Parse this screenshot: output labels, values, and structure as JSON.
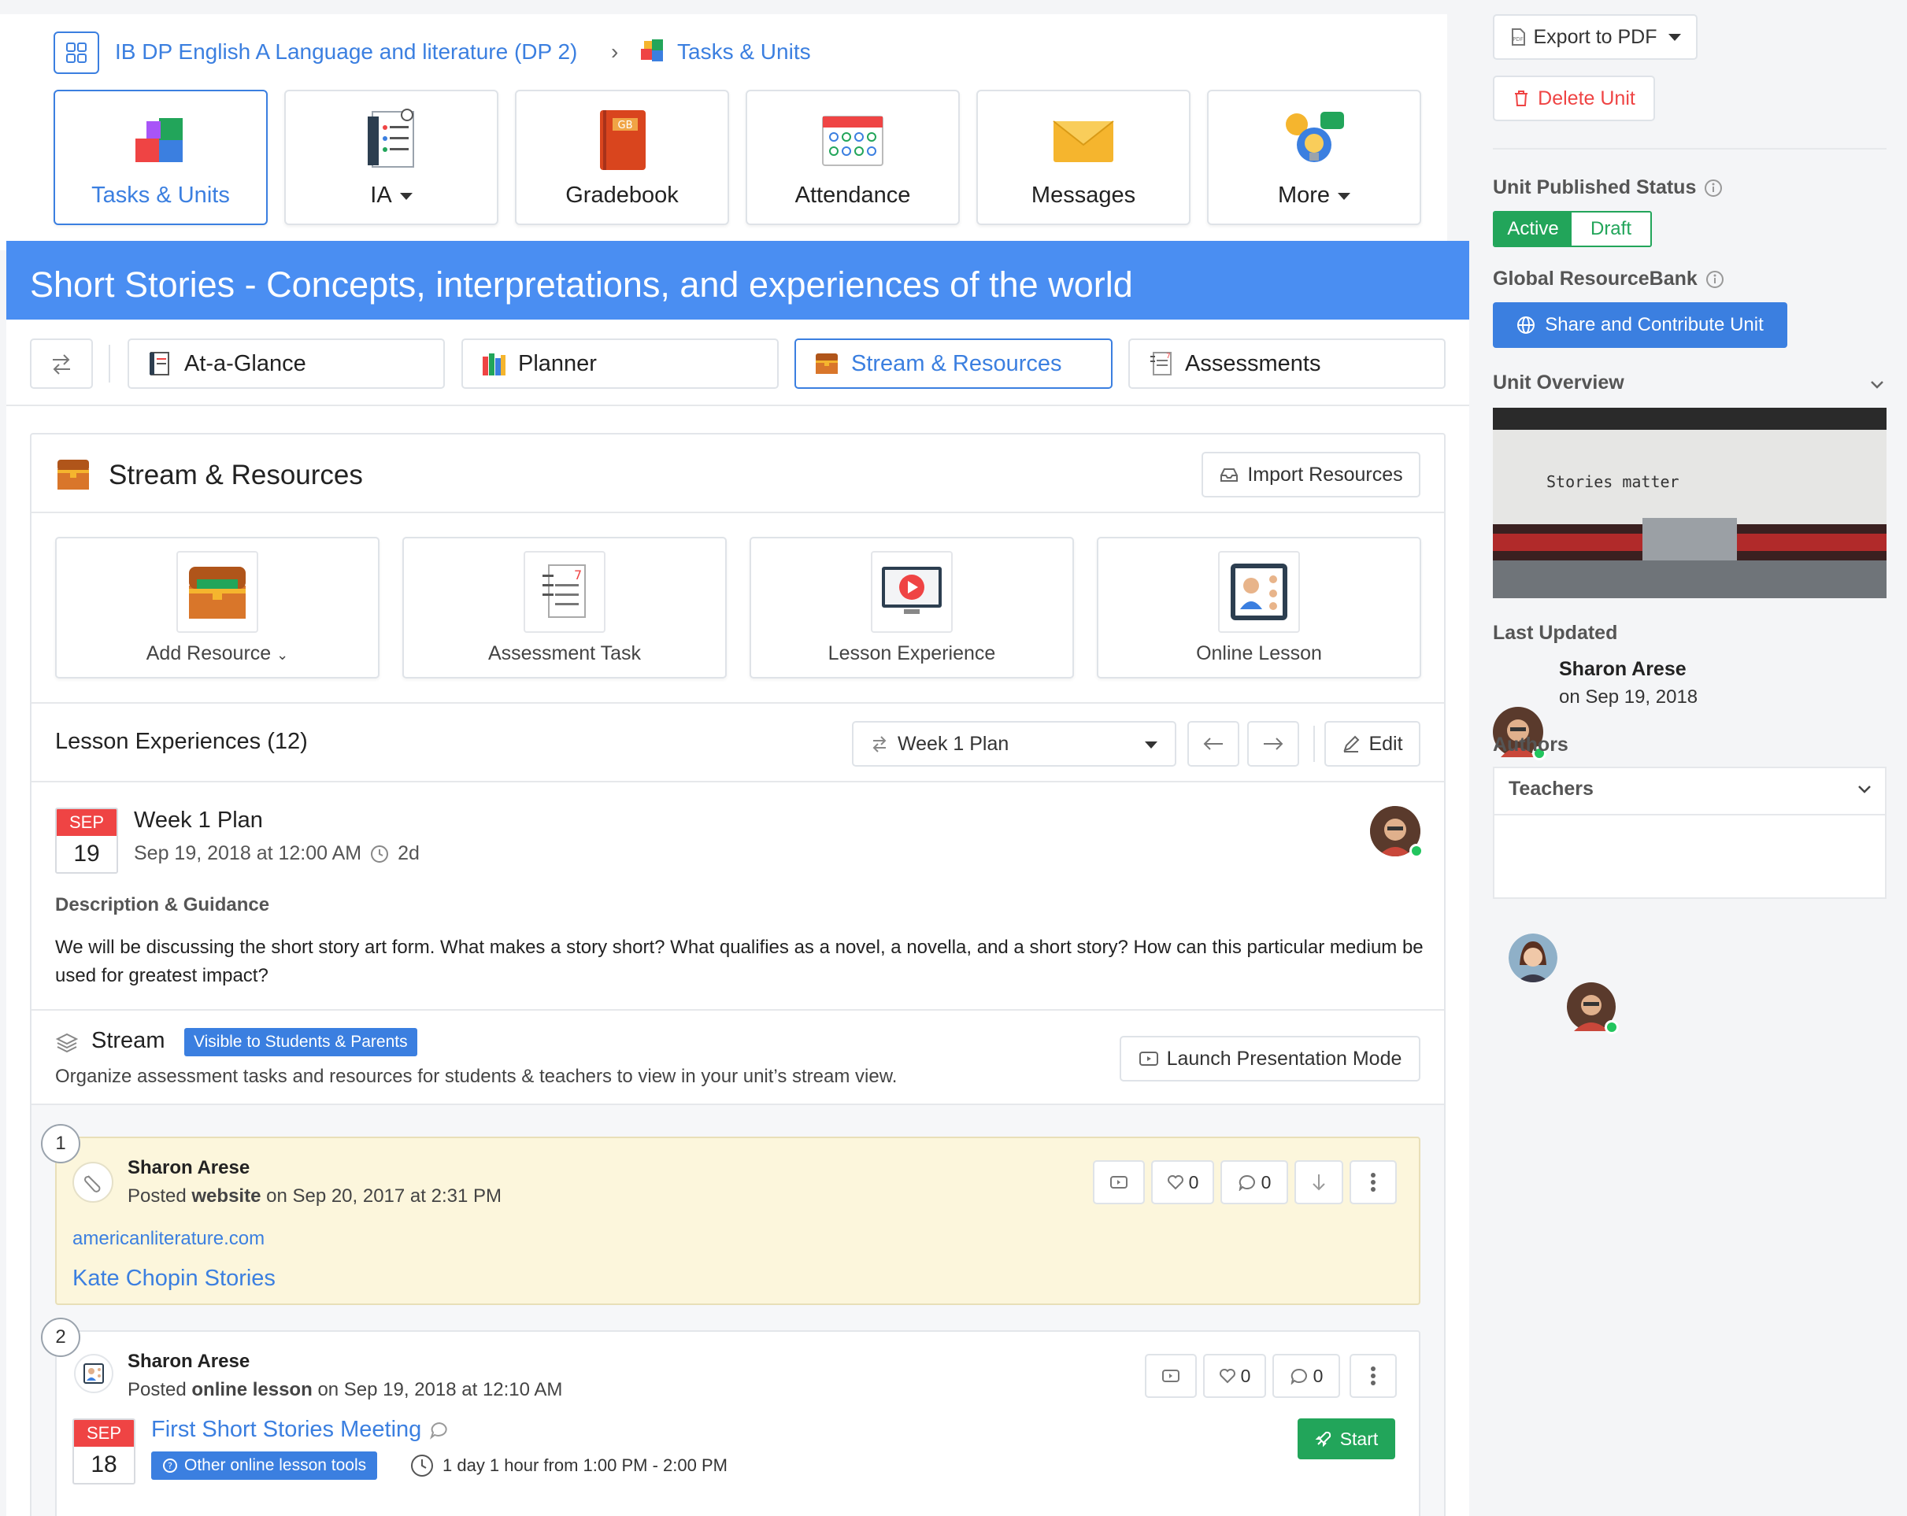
{
  "breadcrumb": {
    "course": "IB DP English A Language and literature (DP 2)",
    "separator": "›",
    "current": "Tasks & Units"
  },
  "nav": [
    {
      "label": "Tasks & Units",
      "icon": "puzzle-icon"
    },
    {
      "label": "IA",
      "icon": "checklist-icon"
    },
    {
      "label": "Gradebook",
      "icon": "gradebook-icon"
    },
    {
      "label": "Attendance",
      "icon": "attendance-calendar-icon"
    },
    {
      "label": "Messages",
      "icon": "envelope-icon"
    },
    {
      "label": "More",
      "icon": "lightbulb-chat-icon"
    }
  ],
  "banner": {
    "title": "Short Stories - Concepts, interpretations, and experiences of the world"
  },
  "tabs": [
    {
      "label": "At-a-Glance",
      "icon": "notebook-icon"
    },
    {
      "label": "Planner",
      "icon": "books-icon"
    },
    {
      "label": "Stream & Resources",
      "icon": "treasure-chest-icon"
    },
    {
      "label": "Assessments",
      "icon": "assessment-doc-icon"
    }
  ],
  "stream_resources": {
    "title": "Stream & Resources",
    "import_label": "Import Resources",
    "tiles": [
      {
        "label": "Add Resource",
        "icon": "treasure-chest-icon"
      },
      {
        "label": "Assessment Task",
        "icon": "assessment-doc-icon"
      },
      {
        "label": "Lesson Experience",
        "icon": "video-play-icon"
      },
      {
        "label": "Online Lesson",
        "icon": "video-call-icon"
      }
    ]
  },
  "lesson_experiences": {
    "title": "Lesson Experiences (12)",
    "plan_select": "Week 1 Plan",
    "edit_label": "Edit"
  },
  "plan": {
    "month": "SEP",
    "day": "19",
    "title": "Week 1 Plan",
    "datetime": "Sep 19, 2018 at 12:00 AM",
    "duration": "2d",
    "desc_heading": "Description & Guidance",
    "description": "We will be discussing the short story art form. What makes a story short? What qualifies as a novel, a novella, and a short story? How can this particular medium be used for greatest impact?"
  },
  "stream": {
    "title": "Stream",
    "badge": "Visible to Students & Parents",
    "subtitle": "Organize assessment tasks and resources for students & teachers to view in your unit’s stream view.",
    "launch_label": "Launch Presentation Mode"
  },
  "posts": [
    {
      "number": "1",
      "author": "Sharon Arese",
      "posted_prefix": "Posted",
      "posted_type": "website",
      "posted_suffix": "on Sep 20, 2017 at 2:31 PM",
      "link_domain": "americanliterature.com",
      "link_title": "Kate Chopin Stories",
      "likes": "0",
      "comments": "0"
    },
    {
      "number": "2",
      "author": "Sharon Arese",
      "posted_prefix": "Posted",
      "posted_type": "online lesson",
      "posted_suffix": "on Sep 19, 2018 at 12:10 AM",
      "likes": "0",
      "comments": "0",
      "month": "SEP",
      "day": "18",
      "lesson_title": "First Short Stories Meeting",
      "tool_badge": "Other online lesson tools",
      "time": "1 day 1 hour from 1:00 PM - 2:00 PM",
      "start_label": "Start"
    }
  ],
  "sidebar": {
    "export_label": "Export to PDF",
    "delete_label": "Delete Unit",
    "published_heading": "Unit Published Status",
    "active_label": "Active",
    "draft_label": "Draft",
    "resourcebank_heading": "Global ResourceBank",
    "share_label": "Share and Contribute Unit",
    "overview_heading": "Unit Overview",
    "overview_image_text": "Stories matter",
    "last_updated_heading": "Last Updated",
    "updated_by": "Sharon Arese",
    "updated_on": "on Sep 19, 2018",
    "authors_heading": "Authors",
    "teachers_label": "Teachers"
  },
  "colors": {
    "accent": "#3b7fe0",
    "banner": "#4a8ef2",
    "active": "#22a55a",
    "danger": "#ef4444",
    "highlight": "#fcf6dc"
  }
}
